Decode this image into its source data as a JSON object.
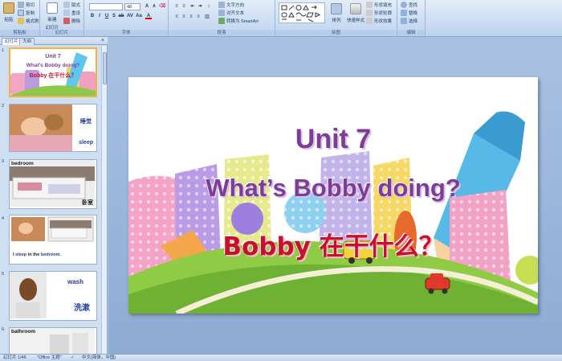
{
  "ribbon": {
    "clipboard": {
      "paste": "粘贴",
      "cut": "剪切",
      "copy": "复制",
      "format_painter": "格式刷",
      "label": "剪贴板"
    },
    "slides": {
      "new_slide": "新建",
      "new_slide2": "幻灯片",
      "layout": "版式",
      "reset": "重设",
      "delete": "删除",
      "label": "幻灯片"
    },
    "font": {
      "font_name": "",
      "font_size": "48",
      "label": "字体"
    },
    "paragraph": {
      "text_direction": "文字方向",
      "align_text": "对齐文本",
      "smartart": "转换为 SmartArt",
      "label": "段落"
    },
    "drawing": {
      "arrange": "排列",
      "quick_styles": "快速样式",
      "fill": "形状填充",
      "outline": "形状轮廓",
      "effects": "形状效果",
      "label": "绘图"
    },
    "editing": {
      "find": "查找",
      "replace": "替换",
      "select": "选择",
      "label": "编辑"
    }
  },
  "panel": {
    "tab_slides": "幻灯片",
    "tab_outline": "大纲",
    "close": "×",
    "thumbs": [
      {
        "num": "1",
        "line1": "Unit 7",
        "line2": "What's Bobby doing?",
        "line3": "Bobby 在干什么？"
      },
      {
        "num": "2",
        "cn": "睡觉",
        "en": "sleep"
      },
      {
        "num": "3",
        "en": "bedroom",
        "cn": "卧室"
      },
      {
        "num": "4",
        "caption_pre": "I ",
        "caption_word1": "sleep",
        "caption_mid": " in the ",
        "caption_word2": "bedroom",
        "caption_end": "."
      },
      {
        "num": "5",
        "en": "wash",
        "cn": "洗漱"
      },
      {
        "num": "6",
        "en": "bathroom"
      }
    ]
  },
  "slide": {
    "title": "Unit 7",
    "question": "What’s Bobby doing?",
    "chinese": "Bobby 在干什么？"
  },
  "status": {
    "slide_info": "幻灯片 1/46",
    "theme": "\"Office 主题\"",
    "language": "中文(简体，中国)"
  }
}
